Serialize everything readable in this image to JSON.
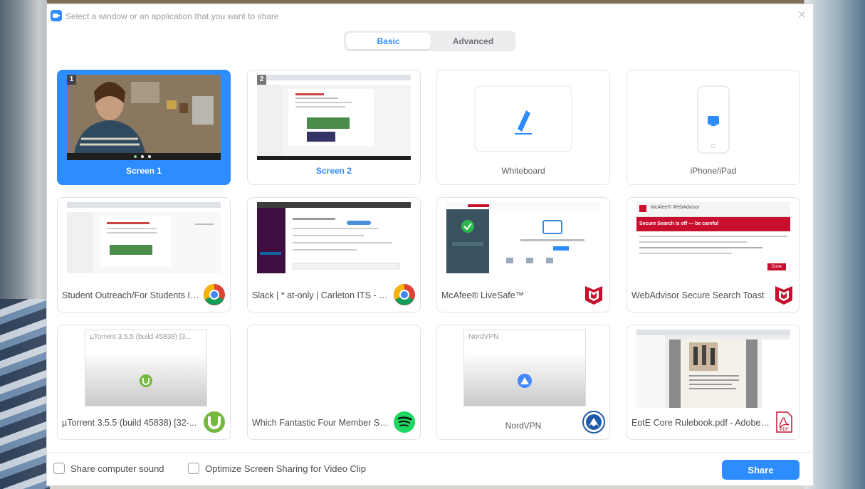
{
  "dialog": {
    "title": "Select a window or an application that you want to share",
    "close_glyph": "×"
  },
  "tabs": [
    {
      "label": "Basic",
      "active": true
    },
    {
      "label": "Advanced",
      "active": false
    }
  ],
  "cards": [
    {
      "label": "Screen 1",
      "number": "1",
      "selected": true
    },
    {
      "label": "Screen 2",
      "number": "2",
      "selected": false
    },
    {
      "label": "Whiteboard"
    },
    {
      "label": "iPhone/iPad"
    },
    {
      "label": "Student Outreach/For Students Id...",
      "app_icon": "chrome-icon"
    },
    {
      "label": "Slack | * at-only | Carleton ITS - G...",
      "app_icon": "chrome-icon"
    },
    {
      "label": "McAfee® LiveSafe™",
      "app_icon": "mcafee-icon"
    },
    {
      "label": "WebAdvisor Secure Search Toast",
      "app_icon": "mcafee-icon"
    },
    {
      "label": "µTorrent 3.5.5  (build 45838) [32-...",
      "thumb_title": "µTorrent 3.5.5  (build 45838) [3...",
      "app_icon": "utorrent-icon"
    },
    {
      "label": "Which Fantastic Four Member Su...",
      "app_icon": "spotify-icon"
    },
    {
      "label": "NordVPN",
      "thumb_title": "NordVPN",
      "app_icon": "nordvpn-icon"
    },
    {
      "label": "EotE Core Rulebook.pdf - Adobe ...",
      "app_icon": "pdf-icon"
    }
  ],
  "webadvisor": {
    "header": "McAfee® WebAdvisor",
    "banner": "Secure Search is off — be careful",
    "done": "Done"
  },
  "pdf_label": "PDF",
  "options": {
    "share_sound": "Share computer sound",
    "optimize_video": "Optimize Screen Sharing for Video Clip"
  },
  "share_button": "Share",
  "colors": {
    "accent": "#2d8cff",
    "mcafee_red": "#c8102e",
    "spotify": "#1ed760"
  }
}
